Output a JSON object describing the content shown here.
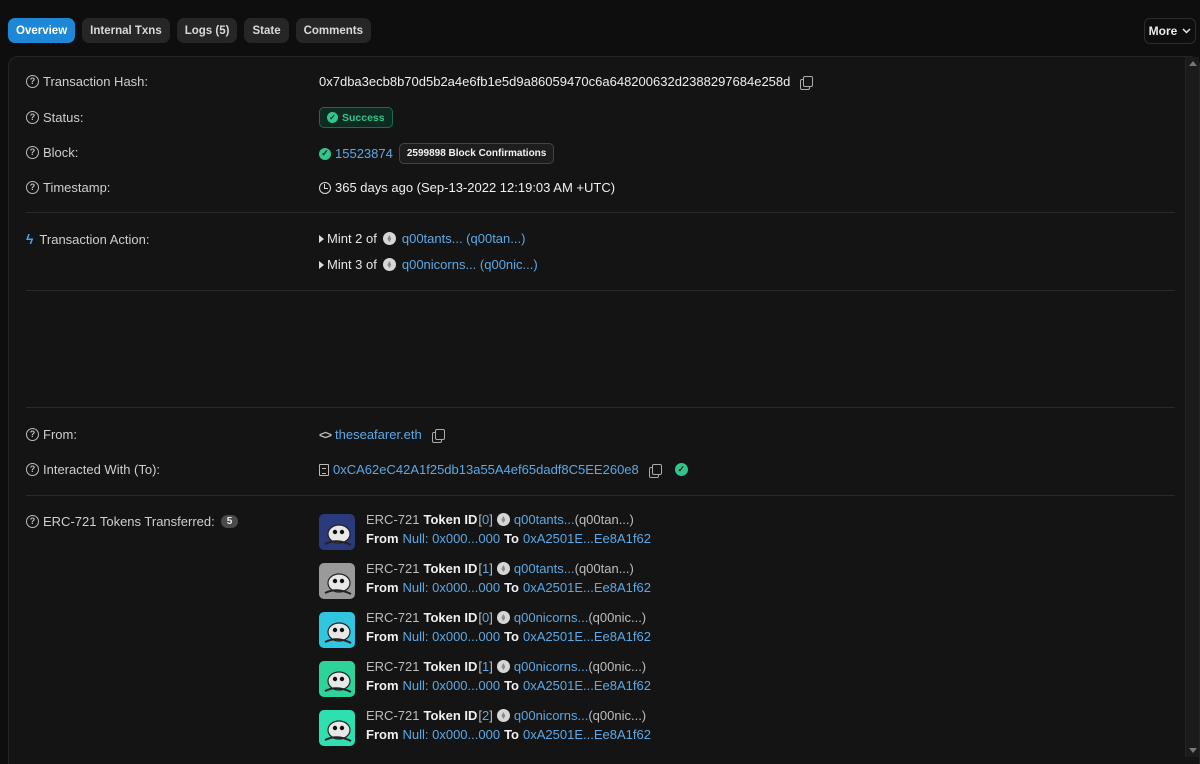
{
  "tabs": [
    {
      "label": "Overview",
      "active": true
    },
    {
      "label": "Internal Txns"
    },
    {
      "label": "Logs (5)"
    },
    {
      "label": "State"
    },
    {
      "label": "Comments"
    }
  ],
  "more_label": "More",
  "overview": {
    "tx_hash": {
      "label": "Transaction Hash:",
      "value": "0x7dba3ecb8b70d5b2a4e6fb1e5d9a86059470c6a648200632d2388297684e258d"
    },
    "status": {
      "label": "Status:",
      "value": "Success"
    },
    "block": {
      "label": "Block:",
      "number": "15523874",
      "confirmations": "2599898 Block Confirmations"
    },
    "timestamp": {
      "label": "Timestamp:",
      "value": "365 days ago (Sep-13-2022 12:19:03 AM +UTC)"
    },
    "action": {
      "label": "Transaction Action:",
      "items": [
        {
          "prefix": "Mint 2 of",
          "token": "q00tants... (q00tan...)"
        },
        {
          "prefix": "Mint 3 of",
          "token": "q00nicorns... (q00nic...)"
        }
      ]
    },
    "from": {
      "label": "From:",
      "value": "theseafarer.eth"
    },
    "to": {
      "label": "Interacted With (To):",
      "value": "0xCA62eC42A1f25db13a55A4ef65dadf8C5EE260e8"
    },
    "erc721": {
      "label": "ERC-721 Tokens Transferred:",
      "count": "5",
      "transfers": [
        {
          "standard": "ERC-721",
          "token_id_label": "Token ID",
          "token_id": "0",
          "name": "q00tants...",
          "symbol": "(q00tan...)",
          "from_label": "From",
          "from": "Null: 0x000...000",
          "to_label": "To",
          "to": "0xA2501E...Ee8A1f62",
          "thumb_bg": "#2a3a7a",
          "thumb": "q00tant-dark"
        },
        {
          "standard": "ERC-721",
          "token_id_label": "Token ID",
          "token_id": "1",
          "name": "q00tants...",
          "symbol": "(q00tan...)",
          "from_label": "From",
          "from": "Null: 0x000...000",
          "to_label": "To",
          "to": "0xA2501E...Ee8A1f62",
          "thumb_bg": "#9a9a9a",
          "thumb": "q00tant-grey"
        },
        {
          "standard": "ERC-721",
          "token_id_label": "Token ID",
          "token_id": "0",
          "name": "q00nicorns...",
          "symbol": "(q00nic...)",
          "from_label": "From",
          "from": "Null: 0x000...000",
          "to_label": "To",
          "to": "0xA2501E...Ee8A1f62",
          "thumb_bg": "#31c6e0",
          "thumb": "q00nicorn-cyan"
        },
        {
          "standard": "ERC-721",
          "token_id_label": "Token ID",
          "token_id": "1",
          "name": "q00nicorns...",
          "symbol": "(q00nic...)",
          "from_label": "From",
          "from": "Null: 0x000...000",
          "to_label": "To",
          "to": "0xA2501E...Ee8A1f62",
          "thumb_bg": "#2ed39a",
          "thumb": "q00nicorn-green"
        },
        {
          "standard": "ERC-721",
          "token_id_label": "Token ID",
          "token_id": "2",
          "name": "q00nicorns...",
          "symbol": "(q00nic...)",
          "from_label": "From",
          "from": "Null: 0x000...000",
          "to_label": "To",
          "to": "0xA2501E...Ee8A1f62",
          "thumb_bg": "#2ee0b0",
          "thumb": "q00nicorn-teal"
        }
      ]
    }
  },
  "colors": {
    "accent": "#1e87d6",
    "link": "#5aa9e6",
    "success": "#33c48d"
  }
}
